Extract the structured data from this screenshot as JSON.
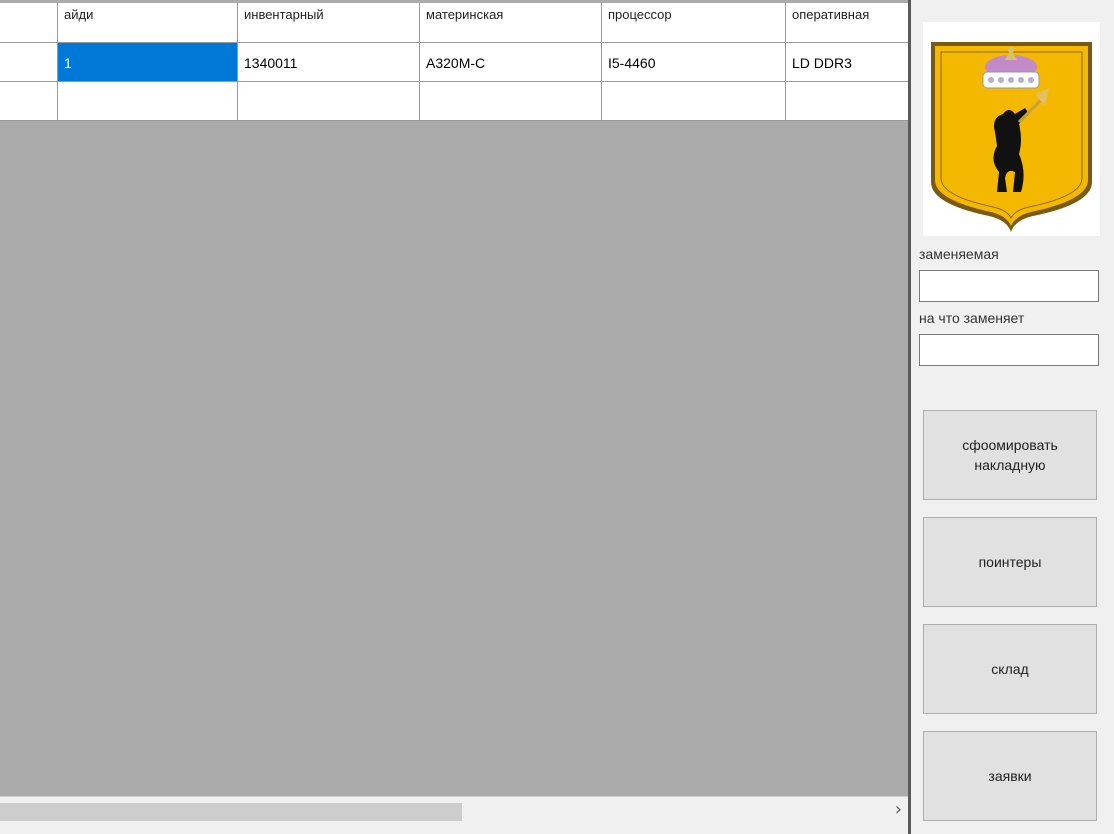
{
  "table": {
    "columns": [
      "айди",
      "инвентарный",
      "материнская",
      "процессор",
      "оперативная"
    ],
    "rows": [
      [
        "1",
        "1340011",
        "A320M-C",
        "I5-4460",
        "LD DDR3"
      ],
      [
        "",
        "",
        "",
        "",
        ""
      ]
    ]
  },
  "form": {
    "replaced_label": "заменяемая",
    "replaced_value": "",
    "replacement_label": "на что заменяет",
    "replacement_value": ""
  },
  "buttons": {
    "invoice": "сфоомировать\nнакладную",
    "printers": "поинтеры",
    "warehouse": "склад",
    "requests": "заявки"
  },
  "scrollbar": {
    "right_arrow": "›"
  },
  "colors": {
    "selection": "#0078d7",
    "grid_background": "#ababab",
    "coat_shield": "#f5b800",
    "crown": "#c8a2c8"
  }
}
